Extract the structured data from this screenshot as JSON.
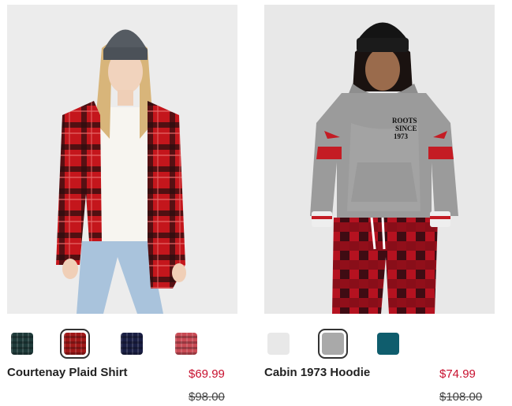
{
  "products": [
    {
      "name": "Courtenay Plaid Shirt",
      "price": "$69.99",
      "original_price": "$98.00",
      "image_alt": "Courtenay Plaid Shirt",
      "swatches": [
        {
          "label": "dark green plaid",
          "color": "#1f3b3a",
          "selected": false
        },
        {
          "label": "red black plaid",
          "color": "#a01818",
          "selected": true
        },
        {
          "label": "navy multicolor plaid",
          "color": "#1a1f44",
          "selected": false
        },
        {
          "label": "red white plaid",
          "color": "#c94b55",
          "selected": false
        }
      ]
    },
    {
      "name": "Cabin 1973 Hoodie",
      "price": "$74.99",
      "original_price": "$108.00",
      "image_alt": "Cabin 1973 Hoodie",
      "graphic_text": "ROOTS SINCE 1973",
      "swatches": [
        {
          "label": "white",
          "color": "#e8e8e8",
          "selected": false
        },
        {
          "label": "grey mix",
          "color": "#a9a9a9",
          "selected": true
        },
        {
          "label": "teal",
          "color": "#0f5d6d",
          "selected": false
        }
      ]
    }
  ],
  "colors": {
    "sale_price": "#c8102e",
    "text": "#222222"
  }
}
